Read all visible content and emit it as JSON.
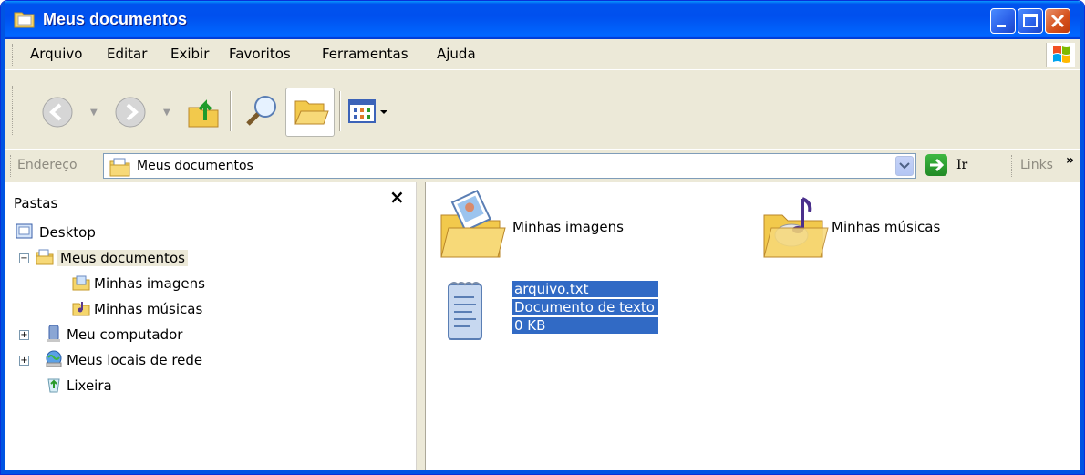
{
  "window": {
    "title": "Meus documentos"
  },
  "menu": {
    "items": [
      "Arquivo",
      "Editar",
      "Exibir",
      "Favoritos",
      "Ferramentas",
      "Ajuda"
    ],
    "mnemonics": [
      "A",
      "d",
      "x",
      "F",
      "e",
      "j"
    ]
  },
  "toolbar": {
    "buttons": [
      "back-icon",
      "forward-icon",
      "up-folder-icon",
      "search-icon",
      "folders-icon",
      "views-icon"
    ]
  },
  "address": {
    "label": "Endereço",
    "value": "Meus documentos",
    "go_label": "Ir",
    "links_label": "Links",
    "links_chevron": "»"
  },
  "folders_pane": {
    "title": "Pastas",
    "close": "×",
    "tree": [
      {
        "label": "Desktop",
        "icon": "desktop-icon",
        "expander": ""
      },
      {
        "label": "Meus documentos",
        "icon": "my-documents-icon",
        "expander": "−",
        "selected": true
      },
      {
        "label": "Minhas imagens",
        "icon": "my-pictures-icon",
        "expander": ""
      },
      {
        "label": "Minhas músicas",
        "icon": "my-music-icon",
        "expander": ""
      },
      {
        "label": "Meu computador",
        "icon": "my-computer-icon",
        "expander": "+"
      },
      {
        "label": "Meus locais de rede",
        "icon": "network-places-icon",
        "expander": "+"
      },
      {
        "label": "Lixeira",
        "icon": "recycle-bin-icon",
        "expander": ""
      }
    ]
  },
  "files": [
    {
      "name": "Minhas imagens",
      "icon": "pictures-folder-icon"
    },
    {
      "name": "Minhas músicas",
      "icon": "music-folder-icon"
    },
    {
      "name": "arquivo.txt",
      "type": "Documento de texto",
      "size": "0 KB",
      "icon": "text-file-icon",
      "selected": true
    }
  ],
  "colors": {
    "titlebar": "#0054e3",
    "selection": "#316ac5",
    "chrome": "#ece9d8"
  }
}
